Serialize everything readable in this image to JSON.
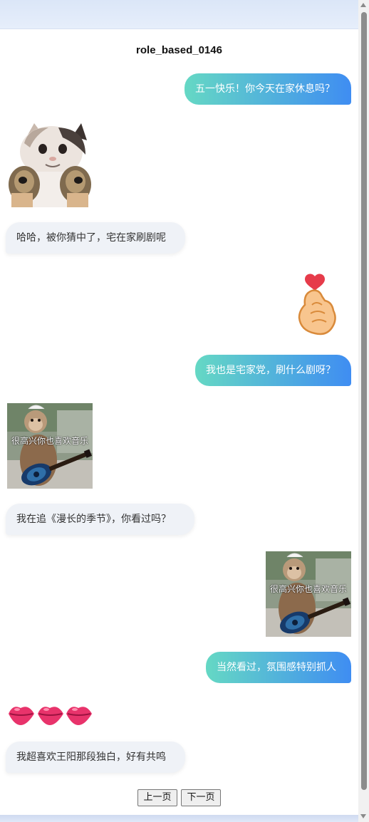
{
  "page": {
    "title": "role_based_0146"
  },
  "messages": [
    {
      "id": 1,
      "side": "right",
      "type": "text",
      "text": "五一快乐！你今天在家休息吗？"
    },
    {
      "id": 2,
      "side": "left",
      "type": "image",
      "sticker": "cat-with-dog-hands-sticker"
    },
    {
      "id": 3,
      "side": "left",
      "type": "text",
      "text": "哈哈，被你猜中了，宅在家刷剧呢"
    },
    {
      "id": 4,
      "side": "right",
      "type": "emoji",
      "emoji": "finger-heart-icon"
    },
    {
      "id": 5,
      "side": "right",
      "type": "text",
      "text": "我也是宅家党，刷什么剧呀？"
    },
    {
      "id": 6,
      "side": "left",
      "type": "image",
      "sticker": "monkey-guitar-sticker",
      "caption": "很高兴你也喜欢音乐"
    },
    {
      "id": 7,
      "side": "left",
      "type": "text",
      "text": "我在追《漫长的季节》，你看过吗？"
    },
    {
      "id": 8,
      "side": "right",
      "type": "image",
      "sticker": "monkey-guitar-sticker",
      "caption": "很高兴你也喜欢音乐"
    },
    {
      "id": 9,
      "side": "right",
      "type": "text",
      "text": "当然看过，氛围感特别抓人"
    },
    {
      "id": 10,
      "side": "left",
      "type": "emoji",
      "emoji": "kiss-lips-icon",
      "count": 3
    },
    {
      "id": 11,
      "side": "left",
      "type": "text",
      "text": "我超喜欢王阳那段独白，好有共鸣"
    }
  ],
  "pagination": {
    "prev_label": "上一页",
    "next_label": "下一页"
  },
  "colors": {
    "bubble_gradient_start": "#65d8c4",
    "bubble_gradient_end": "#3f8df2",
    "left_bubble_bg": "#eff2f7"
  }
}
